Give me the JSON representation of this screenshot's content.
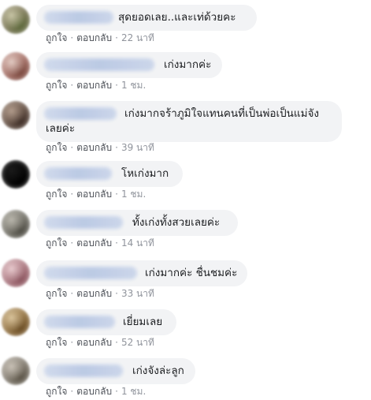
{
  "actions": {
    "like_label": "ถูกใจ",
    "reply_label": "ตอบกลับ",
    "separator": "·"
  },
  "comments": [
    {
      "text": "สุดยอดเลย..และเท่ด้วยคะ",
      "time": "22 นาที",
      "avatar_colors": [
        "#7f7a5a",
        "#c6c3a4",
        "#5e6a3d"
      ]
    },
    {
      "text": "เก่งมากค่ะ",
      "time": "1 ชม.",
      "avatar_colors": [
        "#a9746b",
        "#e1c9c1",
        "#7b4a40"
      ]
    },
    {
      "text": "เก่งมากจร้าภูมิใจแทนคนที่เป็นพ่อเป็นแม่จัง\nเลยค่ะ",
      "time": "39 นาที",
      "avatar_colors": [
        "#6e5a4e",
        "#b09a8a",
        "#3f2f28"
      ]
    },
    {
      "text": "โหเก่งมาก",
      "time": "1 ชม.",
      "avatar_colors": [
        "#0a0a0a",
        "#1a1a1a",
        "#000000"
      ]
    },
    {
      "text": "ทั้งเก่งทั้งสวยเลยค่ะ",
      "time": "14 นาที",
      "avatar_colors": [
        "#7d7b72",
        "#b8b5ab",
        "#4f4d45"
      ]
    },
    {
      "text": "เก่งมากค่ะ ชื่นชมค่ะ",
      "time": "33 นาที",
      "avatar_colors": [
        "#b07e86",
        "#e6c8cc",
        "#8c5660"
      ]
    },
    {
      "text": "เยี่ยมเลย",
      "time": "52 นาที",
      "avatar_colors": [
        "#9a7a4a",
        "#d8c29a",
        "#6b4e26"
      ]
    },
    {
      "text": "เก่งจังล่ะลูก",
      "time": "1 ชม.",
      "avatar_colors": [
        "#8a8378",
        "#c7c0b5",
        "#5c5548"
      ]
    }
  ]
}
